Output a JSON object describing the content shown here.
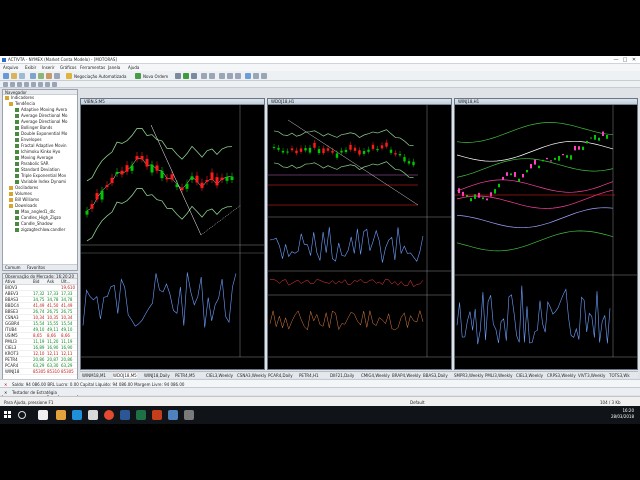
{
  "window": {
    "title": "ACTIVTA - NYMEX (Market Conta Modelo) - [MOTORAS]",
    "minimize": "—",
    "maximize": "□",
    "close": "✕"
  },
  "menu": [
    "Arquivo",
    "Exibir",
    "Inserir",
    "Gráficos",
    "Ferramentas",
    "Janela",
    "Ajuda"
  ],
  "toolbar": {
    "auto_trading": "Negociação Automatizada",
    "new_order": "Nova Ordem"
  },
  "navigator": {
    "title": "Navegador",
    "items": [
      {
        "label": "Indicadores",
        "type": "folder"
      },
      {
        "label": "Tendência",
        "type": "folder"
      },
      {
        "label": "Adaptive Moving Avera",
        "type": "ind"
      },
      {
        "label": "Average Directional Mo",
        "type": "ind"
      },
      {
        "label": "Average Directional Mo",
        "type": "ind"
      },
      {
        "label": "Bollinger Bands",
        "type": "ind"
      },
      {
        "label": "Double Exponential Mo",
        "type": "ind"
      },
      {
        "label": "Envelopes",
        "type": "ind"
      },
      {
        "label": "Fractal Adaptive Movin",
        "type": "ind"
      },
      {
        "label": "Ichimoku Kinko Hyo",
        "type": "ind"
      },
      {
        "label": "Moving Average",
        "type": "ind"
      },
      {
        "label": "Parabolic SAR",
        "type": "ind"
      },
      {
        "label": "Standard Deviation",
        "type": "ind"
      },
      {
        "label": "Triple Exponential Mov",
        "type": "ind"
      },
      {
        "label": "Variable Index Dynami",
        "type": "ind"
      },
      {
        "label": "Osciladores",
        "type": "folder"
      },
      {
        "label": "Volumes",
        "type": "folder"
      },
      {
        "label": "Bill Williams",
        "type": "folder"
      },
      {
        "label": "Downloads",
        "type": "folder"
      },
      {
        "label": "Max_angled1_dlc",
        "type": "ind"
      },
      {
        "label": "Candles_High_Zigzo",
        "type": "ind"
      },
      {
        "label": "Candle_Shadow",
        "type": "ind"
      },
      {
        "label": "zigzagtechlow.candler",
        "type": "ind"
      }
    ],
    "tabs": [
      "Comum",
      "Favoritos"
    ]
  },
  "quotes": {
    "title": "Observação do Mercado: 16:20:20",
    "columns": [
      "Ativo",
      "Bid",
      "Ask",
      "Últ..."
    ],
    "rows": [
      {
        "symbol": "BIOV3",
        "bid": "",
        "ask": "",
        "last": "19,610",
        "dir": "dn"
      },
      {
        "symbol": "ABEV3",
        "bid": "17,32",
        "ask": "17,33",
        "last": "17,33",
        "dir": "up"
      },
      {
        "symbol": "BBAS3",
        "bid": "34,75",
        "ask": "34,78",
        "last": "34,78",
        "dir": "up"
      },
      {
        "symbol": "BBDC4",
        "bid": "41,49",
        "ask": "41,50",
        "last": "41,49",
        "dir": "dn"
      },
      {
        "symbol": "BBSE3",
        "bid": "26,74",
        "ask": "26,75",
        "last": "26,75",
        "dir": "up"
      },
      {
        "symbol": "CSNA3",
        "bid": "10,34",
        "ask": "10,35",
        "last": "10,34",
        "dir": "dn"
      },
      {
        "symbol": "GGBR4",
        "bid": "15,54",
        "ask": "15,55",
        "last": "15,54",
        "dir": "up"
      },
      {
        "symbol": "ITUB4",
        "bid": "49,10",
        "ask": "49,11",
        "last": "49,10",
        "dir": "up"
      },
      {
        "symbol": "USIM5",
        "bid": "8,65",
        "ask": "8,66",
        "last": "8,66",
        "dir": "dn"
      },
      {
        "symbol": "PMLI3",
        "bid": "11,19",
        "ask": "11,20",
        "last": "11,19",
        "dir": "up"
      },
      {
        "symbol": "CIEL3",
        "bid": "16,89",
        "ask": "16,90",
        "last": "16,90",
        "dir": "up"
      },
      {
        "symbol": "KROT3",
        "bid": "12,10",
        "ask": "12,11",
        "last": "12,11",
        "dir": "dn"
      },
      {
        "symbol": "PETR4",
        "bid": "20,86",
        "ask": "20,87",
        "last": "20,86",
        "dir": "up"
      },
      {
        "symbol": "PCAR4",
        "bid": "63,29",
        "ask": "63,30",
        "last": "63,29",
        "dir": "up"
      },
      {
        "symbol": "WINJ18",
        "bid": "85305",
        "ask": "85310",
        "last": "85305",
        "dir": "dn"
      }
    ],
    "tabs": [
      "Ativos",
      "Detalhes",
      "Negociação",
      "Ti..."
    ]
  },
  "charts": [
    {
      "title": "VIBN,S:M5",
      "sub1": "MACD(12,26,9)",
      "sub2": ""
    },
    {
      "title": "WDOJ18,H1",
      "sub1": "MACD",
      "sub2": "Stochastic Momentum, 1062.10 1080 1081"
    },
    {
      "title": "WINJ18,H1",
      "sub1": "WPR(14) 74",
      "sub2": ""
    }
  ],
  "chart_tabs": [
    "WINM18,M1",
    "WDOJ18,M5",
    "WINJ18,Daily",
    "PETR4,M5",
    "CIEL3,Weekly",
    "CSNA3,Weekly",
    "PCAR4,Daily",
    "PETR4,H1",
    "DIIF21,Daily",
    "CMIG4,Weekly",
    "BRAP4,Weekly",
    "BBAS3,Daily",
    "SMPR3,Weekly",
    "PMLI3,Weekly",
    "CIEL3,Weekly",
    "CRPS3,Weekly",
    "VIVT3,Weekly",
    "TOTS3,Wk"
  ],
  "account": {
    "text": "Saldo: 94 086.00 BRL  Lucro: 0.00  Capital Líquido: 94 086.00  Margem Livre: 94 086.00"
  },
  "tester": {
    "text": "Testador de Estratégia"
  },
  "status": {
    "help": "Para Ajuda, pressione F1",
    "profile": "Default",
    "bars": "104 / 3 Kb"
  },
  "taskbar": {
    "time": "16:20",
    "date": "28/03/2018"
  },
  "colors": {
    "bull": "#00c800",
    "bear": "#ff1a1a",
    "macd": "#6fa0ff",
    "accent": "#2a6cc8"
  }
}
